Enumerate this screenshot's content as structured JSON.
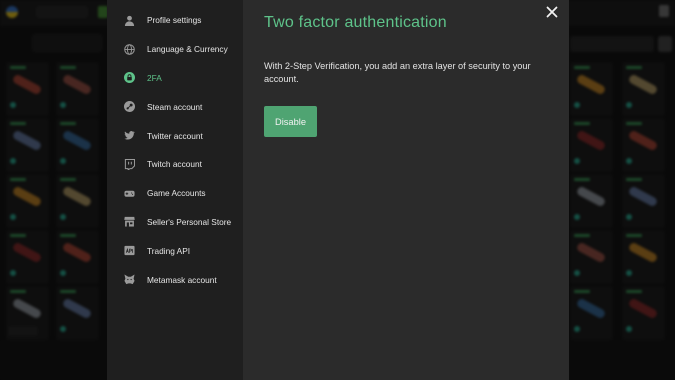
{
  "sidebar": {
    "items": [
      {
        "label": "Profile settings",
        "icon": "user-icon"
      },
      {
        "label": "Language & Currency",
        "icon": "globe-icon"
      },
      {
        "label": "2FA",
        "icon": "lock-icon"
      },
      {
        "label": "Steam account",
        "icon": "steam-icon"
      },
      {
        "label": "Twitter account",
        "icon": "twitter-icon"
      },
      {
        "label": "Twitch account",
        "icon": "twitch-icon"
      },
      {
        "label": "Game Accounts",
        "icon": "gamepad-icon"
      },
      {
        "label": "Seller's Personal Store",
        "icon": "store-icon"
      },
      {
        "label": "Trading API",
        "icon": "api-icon"
      },
      {
        "label": "Metamask account",
        "icon": "fox-icon"
      }
    ],
    "active_index": 2
  },
  "panel": {
    "title": "Two factor authentication",
    "description": "With 2-Step Verification, you add an extra layer of security to your account.",
    "disable_label": "Disable"
  },
  "colors": {
    "accent": "#5ec38a",
    "button": "#4fa472",
    "sidebar_bg": "#1f1f1f",
    "content_bg": "#2b2b2b"
  }
}
